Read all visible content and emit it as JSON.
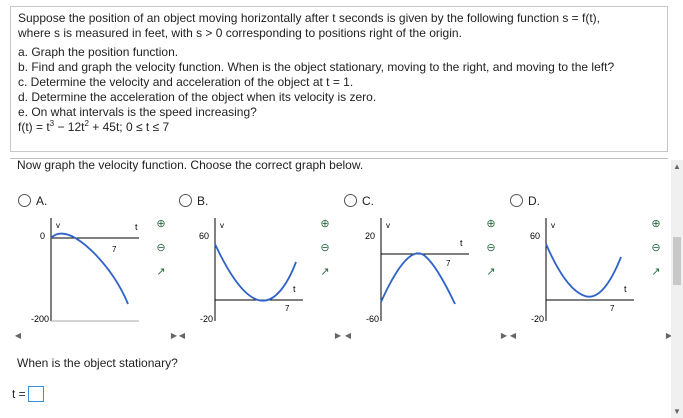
{
  "problem": {
    "intro1": "Suppose the position of an object moving horizontally after t seconds is given by the following function s = f(t),",
    "intro2": "where s is measured in feet, with s > 0 corresponding to positions right of the origin.",
    "parts": [
      "a. Graph the position function.",
      "b. Find and graph the velocity function. When is the object stationary, moving to the right, and moving to the left?",
      "c. Determine the velocity and acceleration of the object at t = 1.",
      "d. Determine the acceleration of the object when its velocity is zero.",
      "e. On what intervals is the speed increasing?"
    ],
    "function": {
      "prefix": "f(t) = t",
      "exp1": "3",
      "mid": " − 12t",
      "exp2": "2",
      "suffix": " + 45t; 0 ≤ t ≤ 7"
    }
  },
  "prompt": "Now graph the velocity function. Choose the correct graph below.",
  "options": [
    {
      "label": "A.",
      "ytop": "0",
      "ybottom": "-200",
      "xlabel": "t",
      "xmax": "7",
      "ylabel": "v"
    },
    {
      "label": "B.",
      "ytop": "60",
      "ybottom": "-20",
      "xlabel": "t",
      "xmax": "7",
      "ylabel": "v"
    },
    {
      "label": "C.",
      "ytop": "20",
      "ybottom": "-60",
      "xlabel": "t",
      "xmax": "7",
      "ylabel": "v"
    },
    {
      "label": "D.",
      "ytop": "60",
      "ybottom": "-20",
      "xlabel": "t",
      "xmax": "7",
      "ylabel": "v"
    }
  ],
  "tool_icons": [
    "zoom-in-icon",
    "zoom-out-icon",
    "external-link-icon"
  ],
  "question": "When is the object stationary?",
  "answer_label": "t =",
  "colors": {
    "curve": "#2f63c8",
    "tool": "#2b6b40",
    "answer_border": "#3a8ed6"
  }
}
